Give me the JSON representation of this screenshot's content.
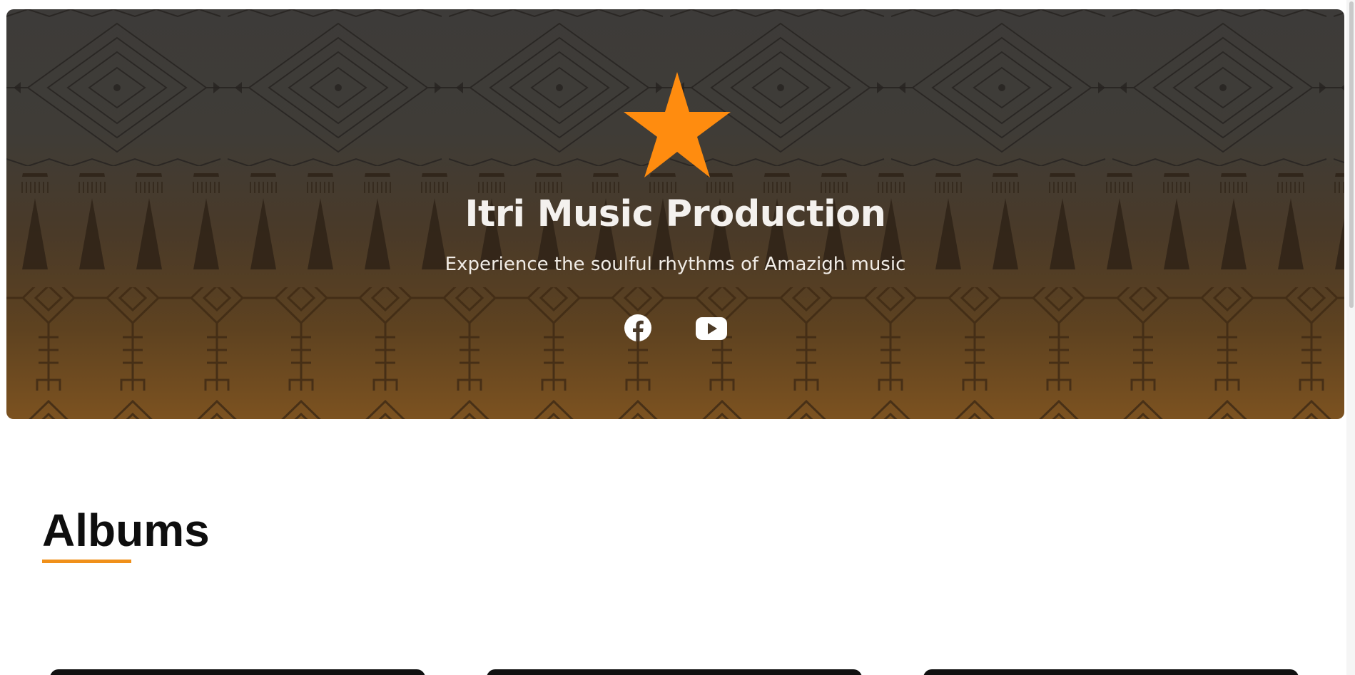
{
  "hero": {
    "title": "Itri Music Production",
    "subtitle": "Experience the soulful rhythms of Amazigh music",
    "logo_icon": "star-icon",
    "logo_color": "#FF8C0F",
    "social": [
      {
        "name": "facebook",
        "icon": "facebook-icon"
      },
      {
        "name": "youtube",
        "icon": "youtube-icon"
      }
    ]
  },
  "albums": {
    "heading": "Albums",
    "accent_color": "#F0901A"
  }
}
